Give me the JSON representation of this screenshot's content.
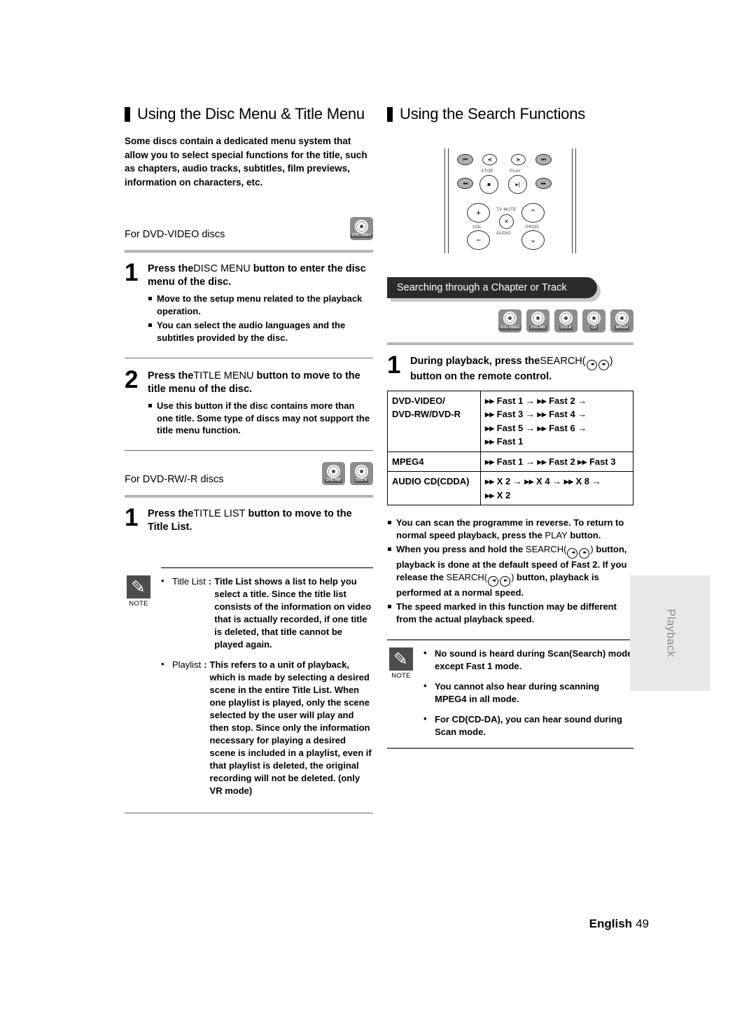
{
  "left": {
    "heading": "Using the Disc Menu & Title Menu",
    "intro": "Some discs contain a dedicated menu system that allow you to select special functions for the title, such as chapters, audio tracks, subtitles, film previews, information on characters, etc.",
    "disc_label_1": "For DVD-VIDEO discs",
    "disc_icons_1": [
      "DVD-VIDEO"
    ],
    "step1": {
      "num": "1",
      "title_a": "Press the",
      "title_b": "DISC MENU",
      "title_c": "button to enter the disc menu of the disc.",
      "bullets": [
        "Move to the setup menu related to the playback operation.",
        "You can select the audio languages and the subtitles provided by the disc."
      ]
    },
    "step2": {
      "num": "2",
      "title_a": "Press the",
      "title_b": "TITLE MENU",
      "title_c": "button to move to the title menu of the disc.",
      "bullets": [
        "Use this button if the disc contains more than one title. Some type of discs may not support the title menu function."
      ]
    },
    "disc_label_2": "For DVD-RW/-R discs",
    "disc_icons_2": [
      "DVD-RW",
      "DVD-R"
    ],
    "step3": {
      "num": "1",
      "title_a": "Press the",
      "title_b": "TITLE LIST",
      "title_c": "button to move to the Title List."
    },
    "note": {
      "caption": "NOTE",
      "items": [
        {
          "term": "Title List",
          "colon": ":",
          "desc": "Title List shows a list to help you select a title. Since the title list consists of the information on video that is actually recorded, if one title is deleted, that title cannot be played again."
        },
        {
          "term": "Playlist",
          "colon": ":",
          "desc": "This refers to a unit of playback, which is made by selecting a desired scene in the entire Title List. When one playlist is played, only the scene selected by the user will play and then stop. Since only the information necessary for playing a desired scene is included in a playlist, even if that playlist is deleted, the original recording will not be deleted. (only VR mode)"
        }
      ]
    }
  },
  "right": {
    "heading": "Using the Search Functions",
    "remote": {
      "labels": {
        "stop": "STOP",
        "play": "PLAY",
        "vol": "VOL",
        "prog": "PROG",
        "tv_mute": "TV MUTE",
        "audio": "AUDIO"
      },
      "buttons": {
        "prev_track": "⏮",
        "step_rev": "◂|",
        "step_fwd": "|▸",
        "next_track": "⏭",
        "rew": "◂◂",
        "stop": "■",
        "play_pause": "▸|",
        "ff": "▸▸",
        "vol_up": "+",
        "vol_down": "−",
        "prog_up": "⌃",
        "prog_down": "⌄",
        "mute": "✕"
      }
    },
    "banner": "Searching through a Chapter or Track",
    "disc_icons": [
      "DVD-VIDEO",
      "DVD-RW",
      "DVD-R",
      "CD",
      "MPEG4"
    ],
    "step1": {
      "num": "1",
      "title_a": "During playback, press the",
      "title_b": "SEARCH(",
      "title_c": ")",
      "title_d": "button on the remote control."
    },
    "speed_table": {
      "rows": [
        {
          "key": "DVD-VIDEO/\nDVD-RW/DVD-R",
          "key_lines": [
            "DVD-VIDEO/",
            "DVD-RW/DVD-R"
          ],
          "value_lines": [
            "▸▸ Fast 1 →  ▸▸ Fast 2 →",
            "▸▸ Fast 3 →  ▸▸ Fast 4 →",
            "▸▸ Fast 5 →  ▸▸ Fast 6 →",
            "▸▸ Fast 1"
          ]
        },
        {
          "key_lines": [
            "MPEG4"
          ],
          "value_lines": [
            "▸▸ Fast 1 →  ▸▸ Fast 2  ▸▸ Fast 3"
          ]
        },
        {
          "key_lines": [
            "AUDIO CD(CDDA)"
          ],
          "value_lines": [
            "▸▸  X 2 →  ▸▸  X 4 →  ▸▸  X 8 →",
            "▸▸  X 2"
          ]
        }
      ]
    },
    "bullets": [
      {
        "parts": [
          {
            "t": "You can scan the programme in reverse. To return to normal speed playback, press the ",
            "b": true
          },
          {
            "t": "PLAY",
            "b": false
          },
          {
            "t": " button.",
            "b": true
          }
        ]
      },
      {
        "parts": [
          {
            "t": "When you press and hold the ",
            "b": true
          },
          {
            "t": "SEARCH(",
            "b": false
          },
          {
            "t": "@@",
            "b": false
          },
          {
            "t": ")",
            "b": false
          },
          {
            "t": " button, playback is done at the default speed of Fast 2",
            "b": true
          },
          {
            "t": ". If you release the ",
            "b": true
          },
          {
            "t": "SEARCH(",
            "b": false
          },
          {
            "t": "@@",
            "b": false
          },
          {
            "t": ")",
            "b": false
          },
          {
            "t": " button, playback is performed at a normal speed.",
            "b": true
          }
        ]
      },
      {
        "parts": [
          {
            "t": "The speed marked in this function may be different from the actual playback speed.",
            "b": true
          }
        ]
      }
    ],
    "note": {
      "caption": "NOTE",
      "items": [
        "No sound is heard during Scan(Search) mode except Fast 1 mode.",
        "You cannot also hear during scanning MPEG4 in all mode.",
        "For CD(CD-DA), you can hear sound during Scan mode."
      ]
    }
  },
  "side_tab": {
    "label": "Playback"
  },
  "footer": {
    "language": "English",
    "page": "49"
  },
  "colors": {
    "rule_gray": "#b4b4b4",
    "banner_dark": "#2b2b2b",
    "banner_shadow": "#c9c9c9",
    "note_icon_bg": "#4d4d4d",
    "disc_icon_bg": "#8d8d8d",
    "side_tab_bg": "#e8e8e8",
    "side_tab_text": "#8a8a8a"
  }
}
